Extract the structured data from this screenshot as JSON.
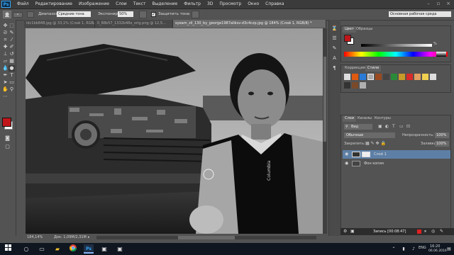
{
  "app": {
    "logo": "Ps"
  },
  "menu": [
    "Файл",
    "Редактирование",
    "Изображение",
    "Слои",
    "Текст",
    "Выделение",
    "Фильтр",
    "3D",
    "Просмотр",
    "Окно",
    "Справка"
  ],
  "options": {
    "range_label": "Диапазон:",
    "range_value": "Средние тона",
    "exposure_label": "Экспонир.:",
    "exposure_value": "50%",
    "protect_tones": "Защитить тона",
    "workspace": "Основная рабочая среда"
  },
  "tabs": [
    {
      "label": "ldc1bb848.jpg @ 33,1% (Слой 1, RGB/8...",
      "active": false
    },
    {
      "label": "0_88b57_1332b48e_orig.png @ 12,5...",
      "active": false
    },
    {
      "label": "syeam_zil_130_by_george1987aliksv-d3c4czp.jpg @ 184% (Слой 1, RGB/8) *",
      "active": true
    }
  ],
  "status": {
    "zoom": "184,14%",
    "doc": "Док: 1,09M/2,31M"
  },
  "panels": {
    "color_tabs": [
      "Цвет",
      "Образцы"
    ],
    "color_value": "%",
    "adjust_tabs": [
      "Коррекция",
      "Стили"
    ],
    "layers_tabs": [
      "Слои",
      "Каналы",
      "Контуры"
    ],
    "kind_label": "Вид",
    "blend_mode": "Обычные",
    "opacity_label": "Непрозрачность:",
    "opacity_value": "100%",
    "lock_label": "Закрепить:",
    "fill_label": "Заливка:",
    "fill_value": "100%",
    "layers": [
      {
        "name": "Слой 1",
        "selected": true
      },
      {
        "name": "Фон копия",
        "selected": false
      }
    ]
  },
  "record": {
    "label": "Запись [00:08:47]"
  },
  "clock": {
    "time": "16:20",
    "date": "06.06.2016",
    "lang": "ENG"
  },
  "colors": {
    "foreground": "#c0161a",
    "background": "#ffffff"
  }
}
